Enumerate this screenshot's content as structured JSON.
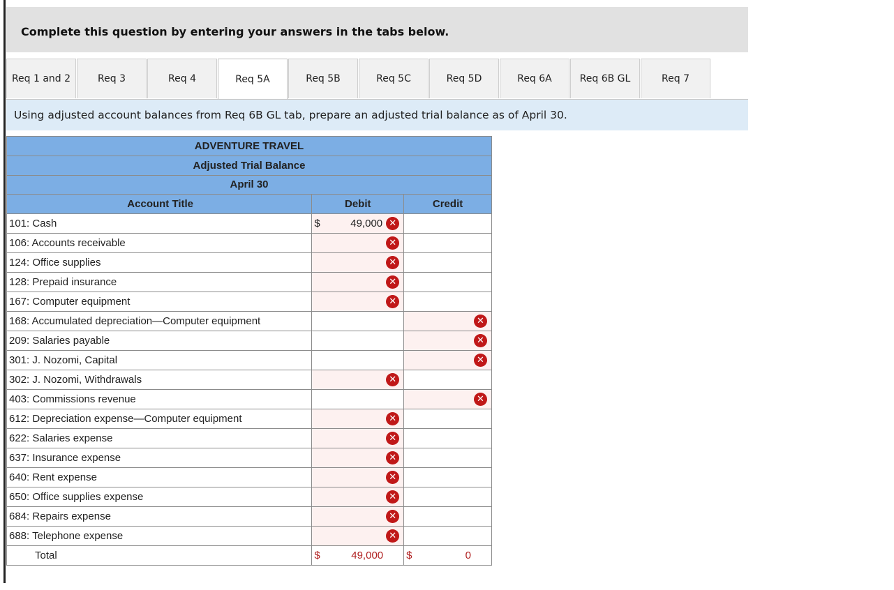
{
  "instruction": "Complete this question by entering your answers in the tabs below.",
  "tabs": [
    {
      "label": "Req 1 and 2",
      "active": false
    },
    {
      "label": "Req 3",
      "active": false
    },
    {
      "label": "Req 4",
      "active": false
    },
    {
      "label": "Req 5A",
      "active": true
    },
    {
      "label": "Req 5B",
      "active": false
    },
    {
      "label": "Req 5C",
      "active": false
    },
    {
      "label": "Req 5D",
      "active": false
    },
    {
      "label": "Req 6A",
      "active": false
    },
    {
      "label": "Req 6B GL",
      "active": false
    },
    {
      "label": "Req 7",
      "active": false
    }
  ],
  "prompt": "Using adjusted account balances from Req 6B GL tab, prepare an adjusted trial balance as of April 30.",
  "table": {
    "company": "ADVENTURE TRAVEL",
    "statement": "Adjusted Trial Balance",
    "date": "April 30",
    "columns": {
      "account": "Account Title",
      "debit": "Debit",
      "credit": "Credit"
    },
    "rows": [
      {
        "account": "101: Cash",
        "debit": "49,000",
        "credit": "",
        "side": "debit",
        "dollar": true,
        "incorrect": true
      },
      {
        "account": "106: Accounts receivable",
        "debit": "",
        "credit": "",
        "side": "debit",
        "dollar": false,
        "incorrect": true
      },
      {
        "account": "124: Office supplies",
        "debit": "",
        "credit": "",
        "side": "debit",
        "dollar": false,
        "incorrect": true
      },
      {
        "account": "128: Prepaid insurance",
        "debit": "",
        "credit": "",
        "side": "debit",
        "dollar": false,
        "incorrect": true
      },
      {
        "account": "167: Computer equipment",
        "debit": "",
        "credit": "",
        "side": "debit",
        "dollar": false,
        "incorrect": true
      },
      {
        "account": "168: Accumulated depreciation—Computer equipment",
        "debit": "",
        "credit": "",
        "side": "credit",
        "dollar": false,
        "incorrect": true
      },
      {
        "account": "209: Salaries payable",
        "debit": "",
        "credit": "",
        "side": "credit",
        "dollar": false,
        "incorrect": true
      },
      {
        "account": "301: J. Nozomi, Capital",
        "debit": "",
        "credit": "",
        "side": "credit",
        "dollar": false,
        "incorrect": true
      },
      {
        "account": "302: J. Nozomi, Withdrawals",
        "debit": "",
        "credit": "",
        "side": "debit",
        "dollar": false,
        "incorrect": true
      },
      {
        "account": "403: Commissions revenue",
        "debit": "",
        "credit": "",
        "side": "credit",
        "dollar": false,
        "incorrect": true
      },
      {
        "account": "612: Depreciation expense—Computer equipment",
        "debit": "",
        "credit": "",
        "side": "debit",
        "dollar": false,
        "incorrect": true
      },
      {
        "account": "622: Salaries expense",
        "debit": "",
        "credit": "",
        "side": "debit",
        "dollar": false,
        "incorrect": true
      },
      {
        "account": "637: Insurance expense",
        "debit": "",
        "credit": "",
        "side": "debit",
        "dollar": false,
        "incorrect": true
      },
      {
        "account": "640: Rent expense",
        "debit": "",
        "credit": "",
        "side": "debit",
        "dollar": false,
        "incorrect": true
      },
      {
        "account": "650: Office supplies expense",
        "debit": "",
        "credit": "",
        "side": "debit",
        "dollar": false,
        "incorrect": true
      },
      {
        "account": "684: Repairs expense",
        "debit": "",
        "credit": "",
        "side": "debit",
        "dollar": false,
        "incorrect": true
      },
      {
        "account": "688: Telephone expense",
        "debit": "",
        "credit": "",
        "side": "debit",
        "dollar": false,
        "incorrect": true
      }
    ],
    "total": {
      "label": "Total",
      "currency": "$",
      "debit": "49,000",
      "credit": "0"
    },
    "currency_symbol": "$",
    "incorrect_icon": "x-circle-icon",
    "colors": {
      "header_bg": "#7caee4",
      "error_icon": "#c01818",
      "error_cell_bg": "#fdf1f0",
      "total_text": "#b02020",
      "prompt_bg": "#ddebf7",
      "instruction_bg": "#e1e1e1"
    }
  }
}
